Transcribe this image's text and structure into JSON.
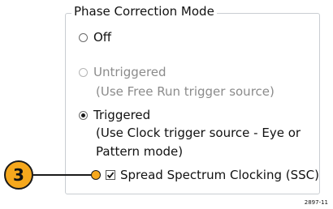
{
  "group": {
    "title": "Phase Correction Mode"
  },
  "options": [
    {
      "label": "Off",
      "selected": false,
      "enabled": true
    },
    {
      "label": "Untriggered",
      "description": "(Use Free Run trigger source)",
      "selected": false,
      "enabled": false
    },
    {
      "label": "Triggered",
      "description_line1": "(Use Clock trigger source - Eye or",
      "description_line2": "Pattern mode)",
      "selected": true,
      "enabled": true
    }
  ],
  "ssc_checkbox": {
    "label": "Spread Spectrum Clocking (SSC)",
    "checked": true
  },
  "callout": {
    "number": "3",
    "color": "#f6a81d"
  },
  "figure_id": "2897-11"
}
